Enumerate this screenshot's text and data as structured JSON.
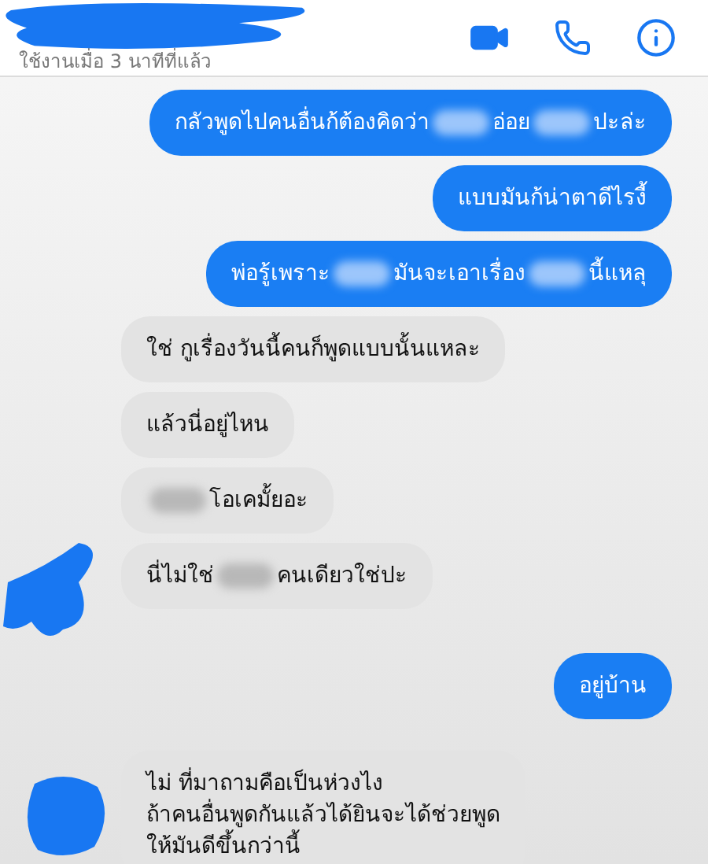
{
  "header": {
    "status": "ใช้งานเมื่อ 3 นาทีที่แล้ว"
  },
  "messages": [
    {
      "kind": "sent",
      "parts": [
        {
          "kind": "text",
          "text": "กลัวพูดไปคนอื่นก้ต้องคิดว่า"
        },
        {
          "kind": "redacted"
        },
        {
          "kind": "text",
          "text": "อ่อย"
        },
        {
          "kind": "redacted"
        },
        {
          "kind": "text",
          "text": "ปะล่ะ"
        }
      ]
    },
    {
      "kind": "sent",
      "parts": [
        {
          "kind": "text",
          "text": "แบบมันก้น่าตาดีไรงี้"
        }
      ]
    },
    {
      "kind": "sent",
      "parts": [
        {
          "kind": "text",
          "text": "พ่อรู้เพราะ"
        },
        {
          "kind": "redacted"
        },
        {
          "kind": "text",
          "text": "มันจะเอาเรื่อง"
        },
        {
          "kind": "redacted"
        },
        {
          "kind": "text",
          "text": "นี้แหลุ"
        }
      ]
    },
    {
      "kind": "received",
      "parts": [
        {
          "kind": "text",
          "text": "ใช่ กูเรื่องวันนี้คนก็พูดแบบนั้นแหละ"
        }
      ]
    },
    {
      "kind": "received",
      "parts": [
        {
          "kind": "text",
          "text": "แล้วนี่อยู่ไหน"
        }
      ]
    },
    {
      "kind": "received",
      "parts": [
        {
          "kind": "redacted"
        },
        {
          "kind": "text",
          "text": "โอเคมั้ยอะ"
        }
      ]
    },
    {
      "kind": "received",
      "parts": [
        {
          "kind": "text",
          "text": "นี่ไม่ใช่"
        },
        {
          "kind": "redacted"
        },
        {
          "kind": "text",
          "text": "คนเดียวใช่ปะ"
        }
      ]
    },
    {
      "kind": "sent",
      "parts": [
        {
          "kind": "text",
          "text": "อยู่บ้าน"
        }
      ]
    },
    {
      "kind": "received",
      "parts": [
        {
          "kind": "text",
          "text": "ไม่ ที่มาถามคือเป็นห่วงไง\nถ้าคนอื่นพูดกันแล้วได้ยินจะได้ช่วยพูด\nให้มันดีขึ้นกว่านี้"
        }
      ]
    }
  ]
}
